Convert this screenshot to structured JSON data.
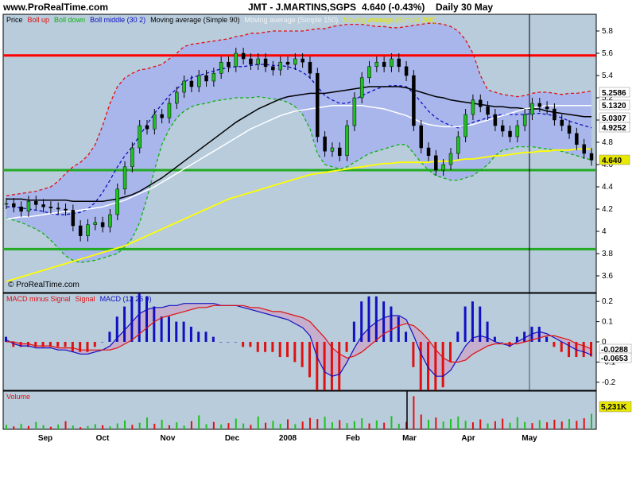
{
  "header": {
    "site": "www.ProRealTime.com",
    "title": "JMT - J.MARTINS,SGPS",
    "quote": "4.640 (-0.43%)",
    "period": "Daily  30 May"
  },
  "price_panel": {
    "legend": [
      {
        "label": "Price",
        "color": "#000000"
      },
      {
        "label": "Boll up",
        "color": "#e01010"
      },
      {
        "label": "Boll down",
        "color": "#10b010"
      },
      {
        "label": "Boll middle (30 2)",
        "color": "#1010c0"
      },
      {
        "label": "Moving average (Simple 90)",
        "color": "#000000"
      },
      {
        "label": "Moving average (Simple 150)",
        "color": "#ffffff"
      },
      {
        "label": "Moving average (Simple 200)",
        "color": "#e8e800"
      }
    ],
    "watermark": "© ProRealTime.com"
  },
  "macd_panel": {
    "legend": [
      {
        "label": "MACD minus Signal",
        "color": "#e01010"
      },
      {
        "label": "Signal",
        "color": "#e01010"
      },
      {
        "label": "MACD (12 26 9)",
        "color": "#1010c0"
      }
    ]
  },
  "volume_panel": {
    "legend": [
      {
        "label": "Volume",
        "color": "#e01010"
      }
    ]
  },
  "chart_data": [
    {
      "type": "line",
      "title": "JMT - J.MARTINS,SGPS",
      "ylim": [
        3.45,
        5.95
      ],
      "yticks": [
        "3.6",
        "3.8",
        "4",
        "4.2",
        "4.4",
        "4.6",
        "4.8",
        "5",
        "5.2",
        "5.4",
        "5.6",
        "5.8"
      ],
      "x_labels": [
        "Sep",
        "Oct",
        "Nov",
        "Dec",
        "2008",
        "Feb",
        "Mar",
        "Apr",
        "May"
      ],
      "horizontal_lines": [
        {
          "value": 5.58,
          "color": "#ff0000"
        },
        {
          "value": 4.55,
          "color": "#22aa22"
        },
        {
          "value": 3.84,
          "color": "#22aa22"
        }
      ],
      "price_labels": [
        {
          "value": "5.2586",
          "bg": "#ffffff",
          "color": "#e01010"
        },
        {
          "value": "5.1320",
          "bg": "#ffffff",
          "color": "#888888"
        },
        {
          "value": "5.0307",
          "bg": "#ffffff",
          "color": "#000000"
        },
        {
          "value": "4.9252",
          "bg": "#ffffff",
          "color": "#1010c0"
        },
        {
          "value": "4.640",
          "bg": "#e8e800",
          "color": "#000000"
        }
      ],
      "series": [
        {
          "name": "Price",
          "values": [
            4.25,
            4.22,
            4.18,
            4.27,
            4.24,
            4.22,
            4.21,
            4.2,
            4.19,
            4.05,
            3.96,
            4.06,
            4.08,
            4.04,
            4.15,
            4.38,
            4.58,
            4.75,
            4.95,
            4.92,
            5.05,
            5.02,
            5.15,
            5.25,
            5.35,
            5.3,
            5.4,
            5.35,
            5.42,
            5.52,
            5.48,
            5.6,
            5.55,
            5.5,
            5.55,
            5.48,
            5.45,
            5.52,
            5.5,
            5.55,
            5.52,
            5.42,
            4.85,
            4.72,
            4.75,
            4.68,
            4.95,
            5.2,
            5.38,
            5.48,
            5.52,
            5.48,
            5.55,
            5.48,
            5.4,
            4.95,
            4.75,
            4.68,
            4.55,
            4.6,
            4.7,
            4.85,
            5.05,
            5.18,
            5.12,
            5.05,
            4.95,
            4.9,
            4.85,
            4.95,
            5.05,
            5.15,
            5.12,
            5.1,
            5.0,
            4.95,
            4.88,
            4.78,
            4.7,
            4.64
          ]
        },
        {
          "name": "Boll up",
          "values": [
            4.32,
            4.33,
            4.34,
            4.35,
            4.36,
            4.38,
            4.4,
            4.45,
            4.52,
            4.58,
            4.62,
            4.68,
            4.78,
            4.95,
            5.15,
            5.3,
            5.38,
            5.42,
            5.45,
            5.46,
            5.48,
            5.5,
            5.55,
            5.6,
            5.66,
            5.68,
            5.69,
            5.7,
            5.71,
            5.72,
            5.73,
            5.75,
            5.76,
            5.78,
            5.78,
            5.79,
            5.8,
            5.8,
            5.8,
            5.8,
            5.8,
            5.81,
            5.82,
            5.82,
            5.84,
            5.85,
            5.86,
            5.86,
            5.86,
            5.85,
            5.84,
            5.84,
            5.83,
            5.83,
            5.84,
            5.85,
            5.86,
            5.87,
            5.87,
            5.86,
            5.84,
            5.8,
            5.72,
            5.6,
            5.4,
            5.27,
            5.25,
            5.23,
            5.22,
            5.21,
            5.22,
            5.24,
            5.25,
            5.25,
            5.24,
            5.23,
            5.24,
            5.24,
            5.25,
            5.26
          ]
        },
        {
          "name": "Boll down",
          "values": [
            4.12,
            4.1,
            4.08,
            4.05,
            4.02,
            3.98,
            3.92,
            3.85,
            3.78,
            3.74,
            3.72,
            3.73,
            3.74,
            3.76,
            3.78,
            3.8,
            3.86,
            3.94,
            4.08,
            4.3,
            4.55,
            4.78,
            4.92,
            5.02,
            5.08,
            5.12,
            5.14,
            5.15,
            5.17,
            5.18,
            5.19,
            5.2,
            5.2,
            5.2,
            5.21,
            5.2,
            5.19,
            5.18,
            5.16,
            5.12,
            5.05,
            4.92,
            4.7,
            4.6,
            4.58,
            4.56,
            4.58,
            4.62,
            4.66,
            4.7,
            4.72,
            4.74,
            4.76,
            4.78,
            4.78,
            4.7,
            4.62,
            4.55,
            4.5,
            4.48,
            4.46,
            4.46,
            4.48,
            4.5,
            4.55,
            4.6,
            4.68,
            4.73,
            4.74,
            4.76,
            4.76,
            4.76,
            4.75,
            4.74,
            4.73,
            4.72,
            4.7,
            4.68,
            4.66,
            4.64
          ]
        },
        {
          "name": "Boll middle (30 2)",
          "values": [
            4.22,
            4.22,
            4.21,
            4.2,
            4.19,
            4.18,
            4.16,
            4.15,
            4.15,
            4.16,
            4.17,
            4.2,
            4.26,
            4.35,
            4.46,
            4.58,
            4.68,
            4.76,
            4.86,
            4.96,
            5.06,
            5.14,
            5.22,
            5.28,
            5.34,
            5.38,
            5.4,
            5.42,
            5.44,
            5.46,
            5.47,
            5.48,
            5.48,
            5.49,
            5.5,
            5.5,
            5.49,
            5.49,
            5.48,
            5.46,
            5.43,
            5.38,
            5.3,
            5.22,
            5.18,
            5.15,
            5.15,
            5.18,
            5.22,
            5.25,
            5.28,
            5.3,
            5.31,
            5.31,
            5.3,
            5.24,
            5.16,
            5.08,
            5.02,
            4.98,
            4.95,
            4.93,
            4.95,
            4.98,
            5.0,
            5.02,
            5.04,
            5.05,
            5.05,
            5.05,
            5.05,
            5.06,
            5.06,
            5.05,
            5.04,
            5.02,
            4.99,
            4.97,
            4.95,
            4.93
          ]
        },
        {
          "name": "Moving average (Simple 90)",
          "values": [
            4.29,
            4.29,
            4.29,
            4.28,
            4.28,
            4.28,
            4.28,
            4.28,
            4.28,
            4.27,
            4.27,
            4.27,
            4.27,
            4.27,
            4.28,
            4.29,
            4.31,
            4.33,
            4.36,
            4.4,
            4.44,
            4.48,
            4.53,
            4.58,
            4.63,
            4.68,
            4.73,
            4.78,
            4.83,
            4.88,
            4.93,
            4.98,
            5.02,
            5.06,
            5.1,
            5.13,
            5.16,
            5.19,
            5.21,
            5.22,
            5.23,
            5.24,
            5.24,
            5.24,
            5.25,
            5.26,
            5.27,
            5.28,
            5.29,
            5.3,
            5.3,
            5.3,
            5.3,
            5.3,
            5.29,
            5.27,
            5.25,
            5.23,
            5.21,
            5.2,
            5.18,
            5.17,
            5.16,
            5.15,
            5.14,
            5.13,
            5.12,
            5.12,
            5.11,
            5.11,
            5.1,
            5.1,
            5.1,
            5.08,
            5.07,
            5.06,
            5.05,
            5.04,
            5.03,
            5.03
          ]
        },
        {
          "name": "Moving average (Simple 150)",
          "values": [
            4.11,
            4.12,
            4.13,
            4.13,
            4.14,
            4.15,
            4.16,
            4.17,
            4.18,
            4.18,
            4.19,
            4.2,
            4.21,
            4.22,
            4.24,
            4.26,
            4.28,
            4.31,
            4.34,
            4.37,
            4.4,
            4.44,
            4.48,
            4.52,
            4.56,
            4.6,
            4.64,
            4.68,
            4.72,
            4.76,
            4.8,
            4.84,
            4.88,
            4.92,
            4.95,
            4.98,
            5.01,
            5.04,
            5.06,
            5.08,
            5.09,
            5.1,
            5.11,
            5.12,
            5.13,
            5.13,
            5.13,
            5.13,
            5.13,
            5.12,
            5.11,
            5.1,
            5.08,
            5.06,
            5.04,
            5.01,
            4.98,
            4.96,
            4.95,
            4.94,
            4.94,
            4.94,
            4.95,
            4.96,
            4.98,
            5.0,
            5.02,
            5.04,
            5.06,
            5.08,
            5.1,
            5.11,
            5.12,
            5.13,
            5.13,
            5.13,
            5.13,
            5.13,
            5.13,
            5.13
          ]
        },
        {
          "name": "Moving average (Simple 200)",
          "values": [
            3.55,
            3.57,
            3.59,
            3.61,
            3.63,
            3.65,
            3.67,
            3.69,
            3.71,
            3.73,
            3.75,
            3.77,
            3.79,
            3.81,
            3.83,
            3.85,
            3.87,
            3.9,
            3.93,
            3.96,
            3.99,
            4.02,
            4.05,
            4.08,
            4.11,
            4.14,
            4.17,
            4.2,
            4.23,
            4.26,
            4.29,
            4.31,
            4.33,
            4.35,
            4.37,
            4.39,
            4.41,
            4.43,
            4.45,
            4.47,
            4.49,
            4.51,
            4.52,
            4.53,
            4.54,
            4.55,
            4.56,
            4.57,
            4.58,
            4.59,
            4.6,
            4.61,
            4.61,
            4.62,
            4.62,
            4.62,
            4.62,
            4.62,
            4.63,
            4.63,
            4.63,
            4.64,
            4.65,
            4.65,
            4.66,
            4.67,
            4.68,
            4.68,
            4.69,
            4.7,
            4.71,
            4.71,
            4.72,
            4.72,
            4.73,
            4.73,
            4.73,
            4.74,
            4.74,
            4.74
          ]
        }
      ]
    },
    {
      "type": "bar",
      "title": "MACD (12 26 9)",
      "ylim": [
        -0.24,
        0.24
      ],
      "yticks": [
        "0.2",
        "0.1",
        "0",
        "-0.1",
        "-0.2"
      ],
      "value_labels": [
        {
          "value": "-0.0288",
          "color": "#e01010"
        },
        {
          "value": "-0.0653",
          "color": "#1010c0"
        }
      ],
      "series": [
        {
          "name": "MACD (12 26 9)",
          "values": [
            0.01,
            -0.01,
            -0.02,
            -0.02,
            -0.03,
            -0.03,
            -0.03,
            -0.04,
            -0.04,
            -0.05,
            -0.06,
            -0.06,
            -0.05,
            -0.04,
            -0.02,
            0.02,
            0.06,
            0.1,
            0.14,
            0.16,
            0.17,
            0.17,
            0.18,
            0.18,
            0.19,
            0.19,
            0.19,
            0.19,
            0.19,
            0.18,
            0.18,
            0.18,
            0.17,
            0.16,
            0.15,
            0.14,
            0.13,
            0.12,
            0.11,
            0.09,
            0.07,
            0.03,
            -0.08,
            -0.15,
            -0.17,
            -0.16,
            -0.1,
            -0.03,
            0.03,
            0.07,
            0.1,
            0.12,
            0.13,
            0.13,
            0.11,
            0.03,
            -0.06,
            -0.13,
            -0.17,
            -0.17,
            -0.14,
            -0.08,
            -0.02,
            0.02,
            0.03,
            0.02,
            0.0,
            -0.01,
            -0.02,
            0.0,
            0.02,
            0.04,
            0.05,
            0.04,
            0.02,
            0.0,
            -0.02,
            -0.04,
            -0.05,
            -0.065
          ]
        },
        {
          "name": "Signal",
          "values": [
            0.0,
            0.0,
            -0.01,
            -0.01,
            -0.02,
            -0.02,
            -0.02,
            -0.03,
            -0.03,
            -0.03,
            -0.04,
            -0.04,
            -0.04,
            -0.04,
            -0.04,
            -0.03,
            -0.01,
            0.01,
            0.04,
            0.07,
            0.1,
            0.12,
            0.13,
            0.14,
            0.15,
            0.16,
            0.17,
            0.17,
            0.18,
            0.18,
            0.18,
            0.18,
            0.18,
            0.17,
            0.17,
            0.16,
            0.15,
            0.15,
            0.14,
            0.13,
            0.12,
            0.1,
            0.06,
            0.02,
            -0.03,
            -0.06,
            -0.08,
            -0.07,
            -0.05,
            -0.02,
            0.01,
            0.04,
            0.06,
            0.08,
            0.09,
            0.08,
            0.05,
            0.01,
            -0.04,
            -0.08,
            -0.1,
            -0.1,
            -0.09,
            -0.06,
            -0.04,
            -0.02,
            -0.01,
            -0.01,
            -0.01,
            -0.01,
            0.0,
            0.01,
            0.02,
            0.03,
            0.03,
            0.02,
            0.01,
            -0.01,
            -0.02,
            -0.036
          ]
        }
      ]
    },
    {
      "type": "bar",
      "title": "Volume",
      "value_labels": [
        {
          "value": "5,231K",
          "bg": "#e8e800"
        }
      ],
      "series": [
        {
          "name": "Volume",
          "values": [
            1.2,
            0.8,
            1.5,
            0.9,
            2.0,
            1.1,
            0.7,
            1.3,
            2.2,
            1.0,
            0.6,
            0.9,
            1.4,
            1.1,
            0.8,
            1.6,
            2.4,
            1.2,
            1.8,
            3.2,
            1.5,
            2.6,
            1.1,
            1.9,
            1.0,
            2.2,
            3.8,
            1.4,
            2.0,
            1.3,
            1.7,
            2.9,
            1.6,
            1.2,
            3.5,
            1.8,
            2.3,
            1.5,
            2.7,
            1.4,
            2.1,
            3.1,
            2.8,
            3.4,
            1.9,
            2.5,
            1.7,
            2.2,
            3.0,
            1.6,
            2.4,
            1.8,
            3.6,
            1.5,
            2.0,
            9.0,
            4.0,
            2.6,
            3.2,
            2.1,
            2.8,
            3.5,
            2.3,
            1.9,
            2.7,
            1.6,
            2.2,
            2.9,
            1.8,
            3.3,
            2.0,
            1.7,
            2.5,
            1.9,
            2.6,
            2.1,
            2.8,
            2.3,
            3.0,
            4.2
          ],
          "up": [
            true,
            false,
            true,
            false,
            true,
            true,
            false,
            true,
            false,
            true,
            false,
            true,
            true,
            false,
            true,
            true,
            true,
            false,
            true,
            true,
            false,
            true,
            false,
            true,
            true,
            false,
            true,
            true,
            false,
            true,
            false,
            true,
            true,
            false,
            true,
            false,
            true,
            true,
            false,
            true,
            false,
            false,
            false,
            true,
            true,
            false,
            true,
            true,
            true,
            false,
            true,
            false,
            true,
            true,
            false,
            false,
            false,
            true,
            false,
            true,
            true,
            true,
            true,
            false,
            false,
            true,
            false,
            false,
            true,
            true,
            true,
            false,
            true,
            false,
            false,
            false,
            true,
            false,
            false,
            true
          ]
        }
      ]
    }
  ]
}
